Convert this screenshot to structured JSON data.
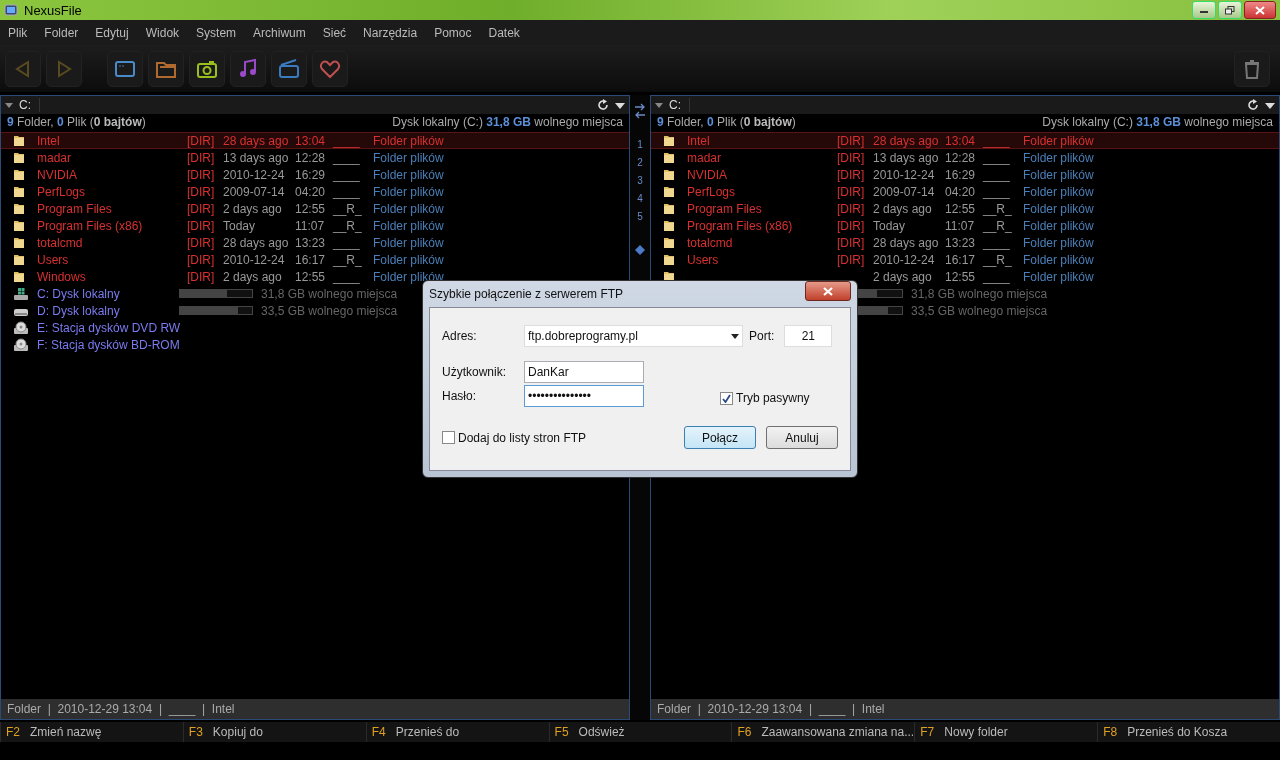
{
  "window": {
    "title": "NexusFile"
  },
  "menu": [
    "Plik",
    "Folder",
    "Edytuj",
    "Widok",
    "System",
    "Archiwum",
    "Sieć",
    "Narzędzia",
    "Pomoc",
    "Datek"
  ],
  "panels": [
    {
      "path": "C:",
      "summary": [
        {
          "text": "9",
          "kind": "num"
        },
        {
          "text": " Folder, ",
          "kind": "plain"
        },
        {
          "text": "0",
          "kind": "num"
        },
        {
          "text": " Plik (",
          "kind": "plain"
        },
        {
          "text": "0 bajtów",
          "kind": "bold"
        },
        {
          "text": ")",
          "kind": "plain"
        }
      ],
      "disk": [
        {
          "text": "Dysk lokalny (C:) ",
          "kind": "plain"
        },
        {
          "text": "31,8 GB",
          "kind": "num"
        },
        {
          "text": " wolnego miejsca",
          "kind": "plain"
        }
      ],
      "rows": [
        {
          "name": "Intel",
          "tag": "[DIR]",
          "date": "28 days ago",
          "time": "13:04",
          "attr": "____",
          "type": "Folder plików",
          "selected": true
        },
        {
          "name": "madar",
          "tag": "[DIR]",
          "date": "13 days ago",
          "time": "12:28",
          "attr": "____",
          "type": "Folder plików",
          "selected": false
        },
        {
          "name": "NVIDIA",
          "tag": "[DIR]",
          "date": "2010-12-24",
          "time": "16:29",
          "attr": "____",
          "type": "Folder plików",
          "selected": false
        },
        {
          "name": "PerfLogs",
          "tag": "[DIR]",
          "date": "2009-07-14",
          "time": "04:20",
          "attr": "____",
          "type": "Folder plików",
          "selected": false
        },
        {
          "name": "Program Files",
          "tag": "[DIR]",
          "date": "2 days ago",
          "time": "12:55",
          "attr": "__R_",
          "type": "Folder plików",
          "selected": false
        },
        {
          "name": "Program Files (x86)",
          "tag": "[DIR]",
          "date": "Today",
          "time": "11:07",
          "attr": "__R_",
          "type": "Folder plików",
          "selected": false
        },
        {
          "name": "totalcmd",
          "tag": "[DIR]",
          "date": "28 days ago",
          "time": "13:23",
          "attr": "____",
          "type": "Folder plików",
          "selected": false
        },
        {
          "name": "Users",
          "tag": "[DIR]",
          "date": "2010-12-24",
          "time": "16:17",
          "attr": "__R_",
          "type": "Folder plików",
          "selected": false
        },
        {
          "name": "Windows",
          "tag": "[DIR]",
          "date": "2 days ago",
          "time": "12:55",
          "attr": "____",
          "type": "Folder plików",
          "selected": false
        }
      ],
      "drives": [
        {
          "kind": "system",
          "name": "C: Dysk lokalny",
          "level": 0.65,
          "free": "31,8 GB wolnego miejsca"
        },
        {
          "kind": "disk",
          "name": "D: Dysk lokalny",
          "level": 0.8,
          "free": "33,5 GB wolnego miejsca"
        },
        {
          "kind": "optical",
          "name": "E:  Stacja dysków DVD RW"
        },
        {
          "kind": "optical",
          "name": "F:  Stacja dysków BD-ROM"
        }
      ],
      "status": "Folder  |  2010-12-29 13:04  |  ____  |  Intel"
    },
    {
      "path": "C:",
      "summary": [
        {
          "text": "9",
          "kind": "num"
        },
        {
          "text": " Folder, ",
          "kind": "plain"
        },
        {
          "text": "0",
          "kind": "num"
        },
        {
          "text": " Plik (",
          "kind": "plain"
        },
        {
          "text": "0 bajtów",
          "kind": "bold"
        },
        {
          "text": ")",
          "kind": "plain"
        }
      ],
      "disk": [
        {
          "text": "Dysk lokalny (C:) ",
          "kind": "plain"
        },
        {
          "text": "31,8 GB",
          "kind": "num"
        },
        {
          "text": " wolnego miejsca",
          "kind": "plain"
        }
      ],
      "rows": [
        {
          "name": "Intel",
          "tag": "[DIR]",
          "date": "28 days ago",
          "time": "13:04",
          "attr": "____",
          "type": "Folder plików",
          "selected": true
        },
        {
          "name": "madar",
          "tag": "[DIR]",
          "date": "13 days ago",
          "time": "12:28",
          "attr": "____",
          "type": "Folder plików",
          "selected": false
        },
        {
          "name": "NVIDIA",
          "tag": "[DIR]",
          "date": "2010-12-24",
          "time": "16:29",
          "attr": "____",
          "type": "Folder plików",
          "selected": false
        },
        {
          "name": "PerfLogs",
          "tag": "[DIR]",
          "date": "2009-07-14",
          "time": "04:20",
          "attr": "____",
          "type": "Folder plików",
          "selected": false
        },
        {
          "name": "Program Files",
          "tag": "[DIR]",
          "date": "2 days ago",
          "time": "12:55",
          "attr": "__R_",
          "type": "Folder plików",
          "selected": false
        },
        {
          "name": "Program Files (x86)",
          "tag": "[DIR]",
          "date": "Today",
          "time": "11:07",
          "attr": "__R_",
          "type": "Folder plików",
          "selected": false
        },
        {
          "name": "totalcmd",
          "tag": "[DIR]",
          "date": "28 days ago",
          "time": "13:23",
          "attr": "____",
          "type": "Folder plików",
          "selected": false
        },
        {
          "name": "Users",
          "tag": "[DIR]",
          "date": "2010-12-24",
          "time": "16:17",
          "attr": "__R_",
          "type": "Folder plików",
          "selected": false
        },
        {
          "date": "2 days ago",
          "time": "12:55",
          "attr": "____",
          "type": "Folder plików",
          "selected": false
        }
      ],
      "drives": [
        {
          "kind": "hidden",
          "level": 0.65,
          "free": "31,8 GB wolnego miejsca"
        },
        {
          "kind": "hidden",
          "level": 0.8,
          "free": "33,5 GB wolnego miejsca"
        }
      ],
      "status": "Folder  |  2010-12-29 13:04  |  ____  |  Intel"
    }
  ],
  "divider": {
    "tabs": [
      "1",
      "2",
      "3",
      "4",
      "5"
    ]
  },
  "function_keys": [
    {
      "key": "F2",
      "label": "Zmień nazwę"
    },
    {
      "key": "F3",
      "label": "Kopiuj do"
    },
    {
      "key": "F4",
      "label": "Przenieś do"
    },
    {
      "key": "F5",
      "label": "Odśwież"
    },
    {
      "key": "F6",
      "label": "Zaawansowana zmiana na..."
    },
    {
      "key": "F7",
      "label": "Nowy folder"
    },
    {
      "key": "F8",
      "label": "Przenieś do Kosza"
    }
  ],
  "dialog": {
    "title": "Szybkie połączenie z serwerem FTP",
    "address_label": "Adres:",
    "address": "ftp.dobreprogramy.pl",
    "port_label": "Port:",
    "port": "21",
    "user_label": "Użytkownik:",
    "user": "DanKar",
    "password_label": "Hasło:",
    "password": "•••••••••••••••",
    "passive": {
      "label": "Tryb pasywny",
      "checked": true
    },
    "add_to_list": {
      "label": "Dodaj do listy stron FTP",
      "checked": false
    },
    "buttons": [
      {
        "label": "Połącz",
        "kind": "default"
      },
      {
        "label": "Anuluj",
        "kind": "normal"
      }
    ]
  }
}
